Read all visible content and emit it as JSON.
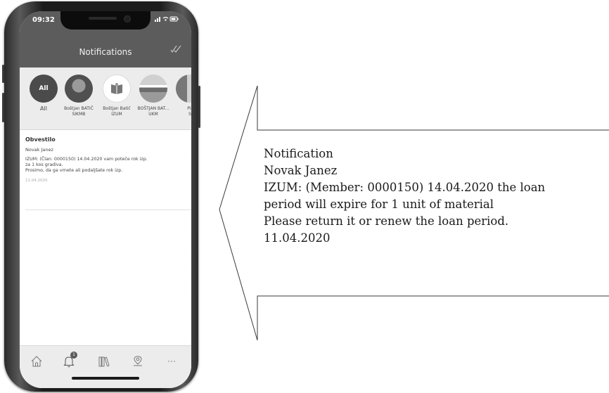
{
  "status_bar": {
    "time": "09:32",
    "icons": "signal-wifi-battery"
  },
  "header": {
    "title": "Notifications",
    "mark_read_icon": "double-check-icon"
  },
  "filters": [
    {
      "circle_text": "All",
      "label_line1": "All",
      "label_line2": ""
    },
    {
      "circle_text": "",
      "label_line1": "Boštjan BATIČ",
      "label_line2": "SIKMB"
    },
    {
      "circle_text": "",
      "label_line1": "Boštjan Batič",
      "label_line2": "IZUM"
    },
    {
      "circle_text": "",
      "label_line1": "BOŠTJAN BAT...",
      "label_line2": "UKM"
    },
    {
      "circle_text": "",
      "label_line1": "Pir",
      "label_line2": "S"
    }
  ],
  "notification": {
    "title": "Obvestilo",
    "name": "Novak Janez",
    "body": "IZUM: (Član: 0000150)  14.04.2020 vam poteče rok izp.\nza 1 kos gradiva.\nProsimo, da ga vrnete ali podaljšate rok izp.",
    "date": "11.04.2020"
  },
  "tabbar": {
    "items": [
      "home-icon",
      "bell-icon",
      "books-icon",
      "location-pin-icon",
      "more-icon"
    ],
    "bell_badge": "1"
  },
  "callout": {
    "lines": [
      "Notification",
      "Novak Janez",
      "IZUM: (Member: 0000150) 14.04.2020 the loan",
      "period will expire for 1 unit of material",
      "Please return it or renew the loan period.",
      "11.04.2020"
    ]
  }
}
